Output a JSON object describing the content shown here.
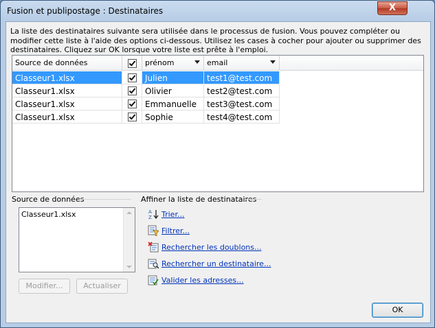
{
  "window": {
    "title": "Fusion et publipostage : Destinataires",
    "close_label": "X"
  },
  "description": "La liste des destinataires suivante sera utilisée dans le processus de fusion. Vous pouvez compléter ou modifier cette liste à l'aide des options ci-dessous. Utilisez les cases à cocher pour ajouter ou supprimer des destinataires. Cliquez sur OK lorsque votre liste est prête à l'emploi.",
  "grid": {
    "columns": [
      "Source de données",
      "",
      "prénom",
      "email"
    ],
    "rows": [
      {
        "source": "Classeur1.xlsx",
        "checked": true,
        "prenom": "Julien",
        "email": "test1@test.com",
        "selected": true
      },
      {
        "source": "Classeur1.xlsx",
        "checked": true,
        "prenom": "Olivier",
        "email": "test2@test.com",
        "selected": false
      },
      {
        "source": "Classeur1.xlsx",
        "checked": true,
        "prenom": "Emmanuelle",
        "email": "test3@test.com",
        "selected": false
      },
      {
        "source": "Classeur1.xlsx",
        "checked": true,
        "prenom": "Sophie",
        "email": "test4@test.com",
        "selected": false
      }
    ]
  },
  "datasource_section": {
    "label": "Source de données",
    "items": [
      "Classeur1.xlsx"
    ],
    "modify_label": "Modifier...",
    "refresh_label": "Actualiser"
  },
  "refine_section": {
    "label": "Affiner la liste de destinataires",
    "links": [
      "Trier...",
      "Filtrer...",
      "Rechercher les doublons...",
      "Rechercher un destinataire...",
      "Valider les adresses..."
    ]
  },
  "ok_label": "OK"
}
